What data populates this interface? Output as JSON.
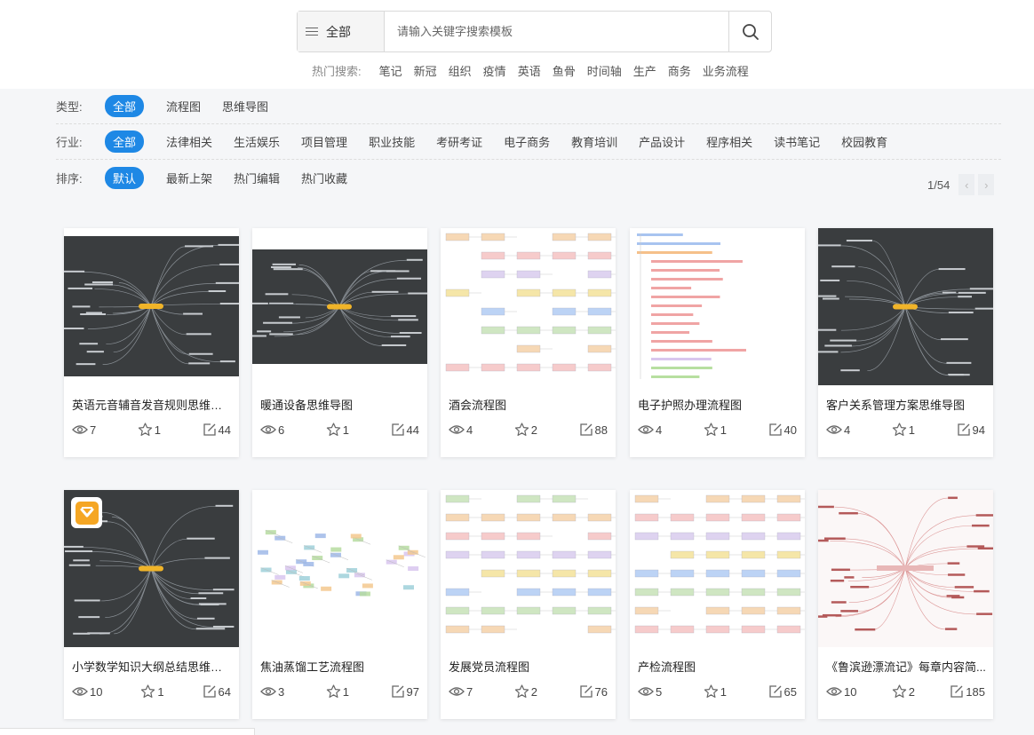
{
  "search": {
    "scope_label": "全部",
    "placeholder": "请输入关键字搜索模板",
    "hot_label": "热门搜索:",
    "hot_keywords": [
      "笔记",
      "新冠",
      "组织",
      "疫情",
      "英语",
      "鱼骨",
      "时间轴",
      "生产",
      "商务",
      "业务流程"
    ]
  },
  "filters": {
    "type": {
      "label": "类型:",
      "options": [
        "全部",
        "流程图",
        "思维导图"
      ],
      "active": "全部"
    },
    "industry": {
      "label": "行业:",
      "options": [
        "全部",
        "法律相关",
        "生活娱乐",
        "项目管理",
        "职业技能",
        "考研考证",
        "电子商务",
        "教育培训",
        "产品设计",
        "程序相关",
        "读书笔记",
        "校园教育"
      ],
      "active": "全部"
    },
    "sort": {
      "label": "排序:",
      "options": [
        "默认",
        "最新上架",
        "热门编辑",
        "热门收藏"
      ],
      "active": "默认"
    }
  },
  "pagination": {
    "text": "1/54",
    "prev_icon": "chevron-left-icon",
    "next_icon": "chevron-right-icon"
  },
  "colors": {
    "accent": "#1e88e5",
    "dark_thumb": "#3a3d3f",
    "badge": "#f5a623"
  },
  "cards": [
    {
      "title": "英语元音辅音发音规则思维导图",
      "views": "7",
      "stars": "1",
      "edits": "44",
      "thumb": "mindmap-dark",
      "badge": false
    },
    {
      "title": "暖通设备思维导图",
      "views": "6",
      "stars": "1",
      "edits": "44",
      "thumb": "mindmap-dark",
      "badge": false
    },
    {
      "title": "酒会流程图",
      "views": "4",
      "stars": "2",
      "edits": "88",
      "thumb": "flowchart-grid",
      "badge": false
    },
    {
      "title": "电子护照办理流程图",
      "views": "4",
      "stars": "1",
      "edits": "40",
      "thumb": "flowchart-list",
      "badge": false
    },
    {
      "title": "客户关系管理方案思维导图",
      "views": "4",
      "stars": "1",
      "edits": "94",
      "thumb": "mindmap-dark",
      "badge": false
    },
    {
      "title": "小学数学知识大纲总结思维导图",
      "views": "10",
      "stars": "1",
      "edits": "64",
      "thumb": "mindmap-dark",
      "badge": true
    },
    {
      "title": "焦油蒸馏工艺流程图",
      "views": "3",
      "stars": "1",
      "edits": "97",
      "thumb": "flowchart-network",
      "badge": false
    },
    {
      "title": "发展党员流程图",
      "views": "7",
      "stars": "2",
      "edits": "76",
      "thumb": "flowchart-grid",
      "badge": false
    },
    {
      "title": "产检流程图",
      "views": "5",
      "stars": "1",
      "edits": "65",
      "thumb": "flowchart-grid",
      "badge": false
    },
    {
      "title": "《鲁滨逊漂流记》每章内容简...",
      "views": "10",
      "stars": "2",
      "edits": "185",
      "thumb": "mindmap-light",
      "badge": false
    }
  ]
}
